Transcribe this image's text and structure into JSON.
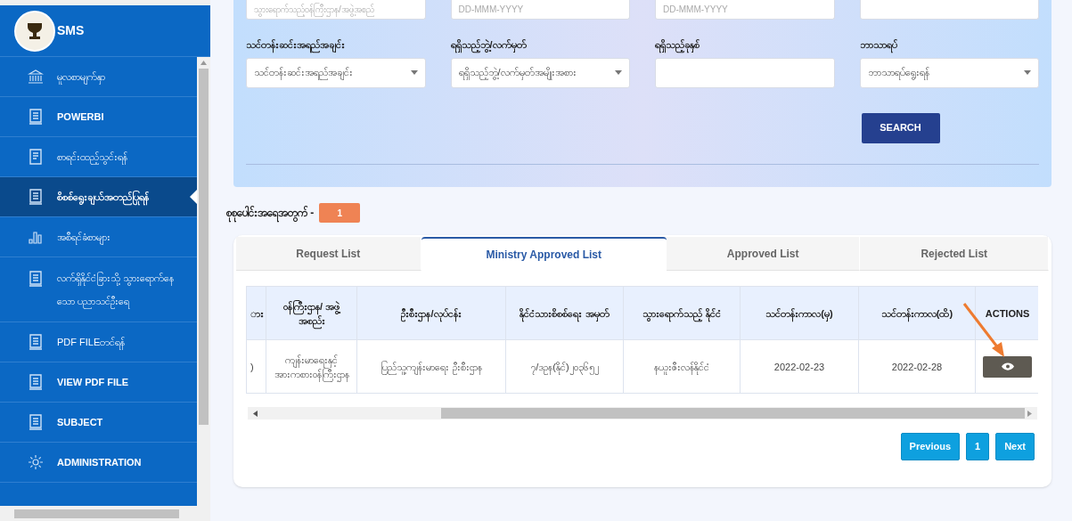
{
  "sidebar": {
    "title": "SMS",
    "items": [
      {
        "kind": "bank",
        "label": "မူလစာမျက်နှာ",
        "selected": false
      },
      {
        "kind": "document",
        "label": "POWERBI",
        "selected": false
      },
      {
        "kind": "form",
        "label": "စာရင်းထည့်သွင်းရန်",
        "selected": false
      },
      {
        "kind": "document",
        "label": "စိစစ်ရွေးချယ်အတည်ပြုရန်",
        "selected": true
      },
      {
        "kind": "chart",
        "label": "အစီရင်ခံစာများ",
        "selected": false
      },
      {
        "kind": "document",
        "label": "လက်ရှိနိုင်ငံခြားသို့ သွားရောက်နေသော ပညာသင်ဦးရေ",
        "selected": false
      },
      {
        "kind": "document",
        "label": "PDF FILEတင်ရန်",
        "selected": false
      },
      {
        "kind": "document",
        "label": "VIEW PDF FILE",
        "selected": false
      },
      {
        "kind": "document",
        "label": "SUBJECT",
        "selected": false
      },
      {
        "kind": "gear",
        "label": "ADMINISTRATION",
        "selected": false
      }
    ]
  },
  "filters": {
    "top_row": [
      {
        "placeholder": "သွားရောက်သည့်ဝန်ကြီးဌာန/အဖွဲ့အစည်"
      },
      {
        "placeholder": "DD-MMM-YYYY"
      },
      {
        "placeholder": "DD-MMM-YYYY"
      }
    ],
    "fields": [
      {
        "label": "သင်တန်းဆင်းအရည်အချင်း",
        "kind": "select",
        "value": "သင်တန်းဆင်းအရည်အချင်း"
      },
      {
        "label": "ရရှိသည့်ဘွဲ့/လက်မှတ်",
        "kind": "select",
        "value": "ရရှိသည့်ဘွဲ့/လက်မှတ်အမျိုးအစား"
      },
      {
        "label": "ရရှိသည့်ခုနှစ်",
        "kind": "input"
      },
      {
        "label": "ဘာသာရပ်",
        "kind": "select",
        "value": "ဘာသာရပ်ရွေးရန်"
      }
    ],
    "search_button": "SEARCH"
  },
  "count": {
    "label": "စုစုပေါင်းအရေအတွက် -",
    "value": "1"
  },
  "tabs": [
    {
      "label": "Request List",
      "selected": false
    },
    {
      "label": "Ministry Approved List",
      "selected": true
    },
    {
      "label": "Approved List",
      "selected": false
    },
    {
      "label": "Rejected List",
      "selected": false
    }
  ],
  "table": {
    "columns": [
      "ား",
      "ဝန်ကြီးဌာန/ အဖွဲ့ အစည်း",
      "ဦးစီးဌာန/လုပ်ငန်း",
      "နိုင်ငံသားစိစစ်ရေး အမှတ်",
      "သွားရောက်သည့် နိုင်ငံ",
      "သင်တန်းကာလ(မှ)",
      "သင်တန်းကာလ(ထိ)",
      "ACTIONS"
    ],
    "rows": [
      {
        "cells": [
          ")",
          "ကျန်းမာရေးနှင့် အားကစားဝန်ကြီးဌာန",
          "ပြည်သူ့ကျန်းမာရေး ဦးစီးဌာန",
          "၇/ဒဥန(နိုင်)၂၀၃၆၅၂",
          "နယူးဇီးလန်နိုင်ငံ",
          "2022-02-23",
          "2022-02-28"
        ]
      }
    ]
  },
  "pagination": [
    {
      "label": "Previous"
    },
    {
      "label": "1"
    },
    {
      "label": "Next"
    }
  ]
}
